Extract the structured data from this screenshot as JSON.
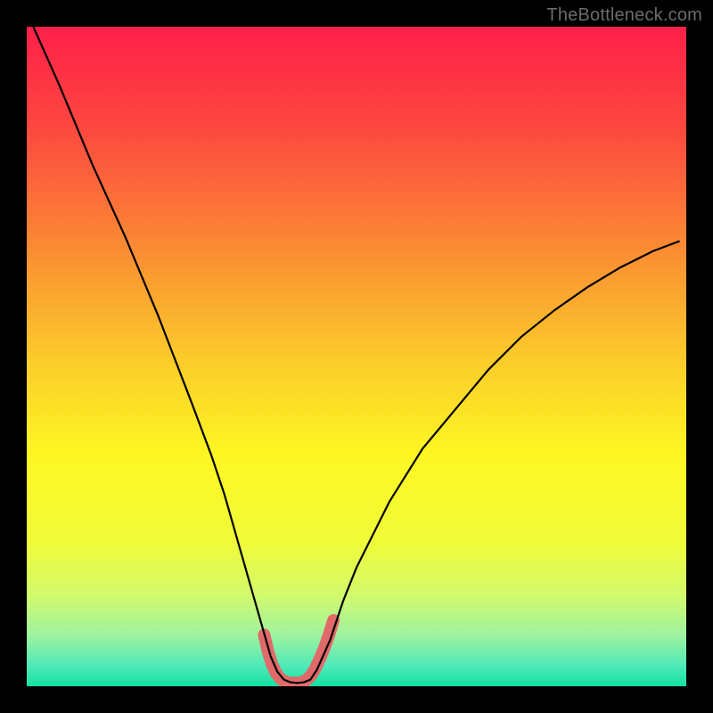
{
  "watermark": "TheBottleneck.com",
  "chart_data": {
    "type": "line",
    "title": "",
    "xlabel": "",
    "ylabel": "",
    "xlim": [
      0,
      100
    ],
    "ylim": [
      0,
      100
    ],
    "grid": false,
    "background_gradient": {
      "stops": [
        {
          "pos": 0.0,
          "color": "#ff1f49"
        },
        {
          "pos": 0.16,
          "color": "#fd4a3f"
        },
        {
          "pos": 0.32,
          "color": "#fb8534"
        },
        {
          "pos": 0.5,
          "color": "#fbca2a"
        },
        {
          "pos": 0.65,
          "color": "#fdf722"
        },
        {
          "pos": 0.78,
          "color": "#f0fb38"
        },
        {
          "pos": 0.86,
          "color": "#d3fa6a"
        },
        {
          "pos": 0.92,
          "color": "#a1f39d"
        },
        {
          "pos": 0.97,
          "color": "#4ee9b8"
        },
        {
          "pos": 1.0,
          "color": "#11e2a0"
        }
      ]
    },
    "series": [
      {
        "name": "bottleneck-curve",
        "color": "#000000",
        "width": 2.2,
        "x": [
          1,
          5,
          10,
          15,
          20,
          25,
          28,
          30,
          32,
          34,
          36,
          37,
          38,
          39,
          40,
          41,
          42,
          43,
          44,
          46,
          48,
          50,
          55,
          60,
          65,
          70,
          75,
          80,
          85,
          90,
          95,
          99
        ],
        "y": [
          100,
          91,
          79,
          68,
          56,
          43,
          35,
          29,
          22,
          15,
          8,
          4.5,
          2.2,
          1.0,
          0.6,
          0.5,
          0.6,
          1.0,
          2.5,
          7,
          13,
          18,
          28,
          36,
          42,
          48,
          53,
          57,
          60.5,
          63.5,
          66,
          67.5
        ]
      },
      {
        "name": "optimal-zone-highlight",
        "color": "#e06a6a",
        "width": 14,
        "linecap": "round",
        "x": [
          36.0,
          36.6,
          37.2,
          37.8,
          38.4,
          39.0,
          39.6,
          40.3,
          41.0,
          41.7,
          42.4,
          43.1,
          43.8,
          44.5,
          45.2,
          45.9,
          46.5
        ],
        "y": [
          7.8,
          5.2,
          3.3,
          2.0,
          1.2,
          0.8,
          0.55,
          0.5,
          0.5,
          0.6,
          0.95,
          1.6,
          2.8,
          4.3,
          6.0,
          8.0,
          10.0
        ]
      }
    ]
  }
}
